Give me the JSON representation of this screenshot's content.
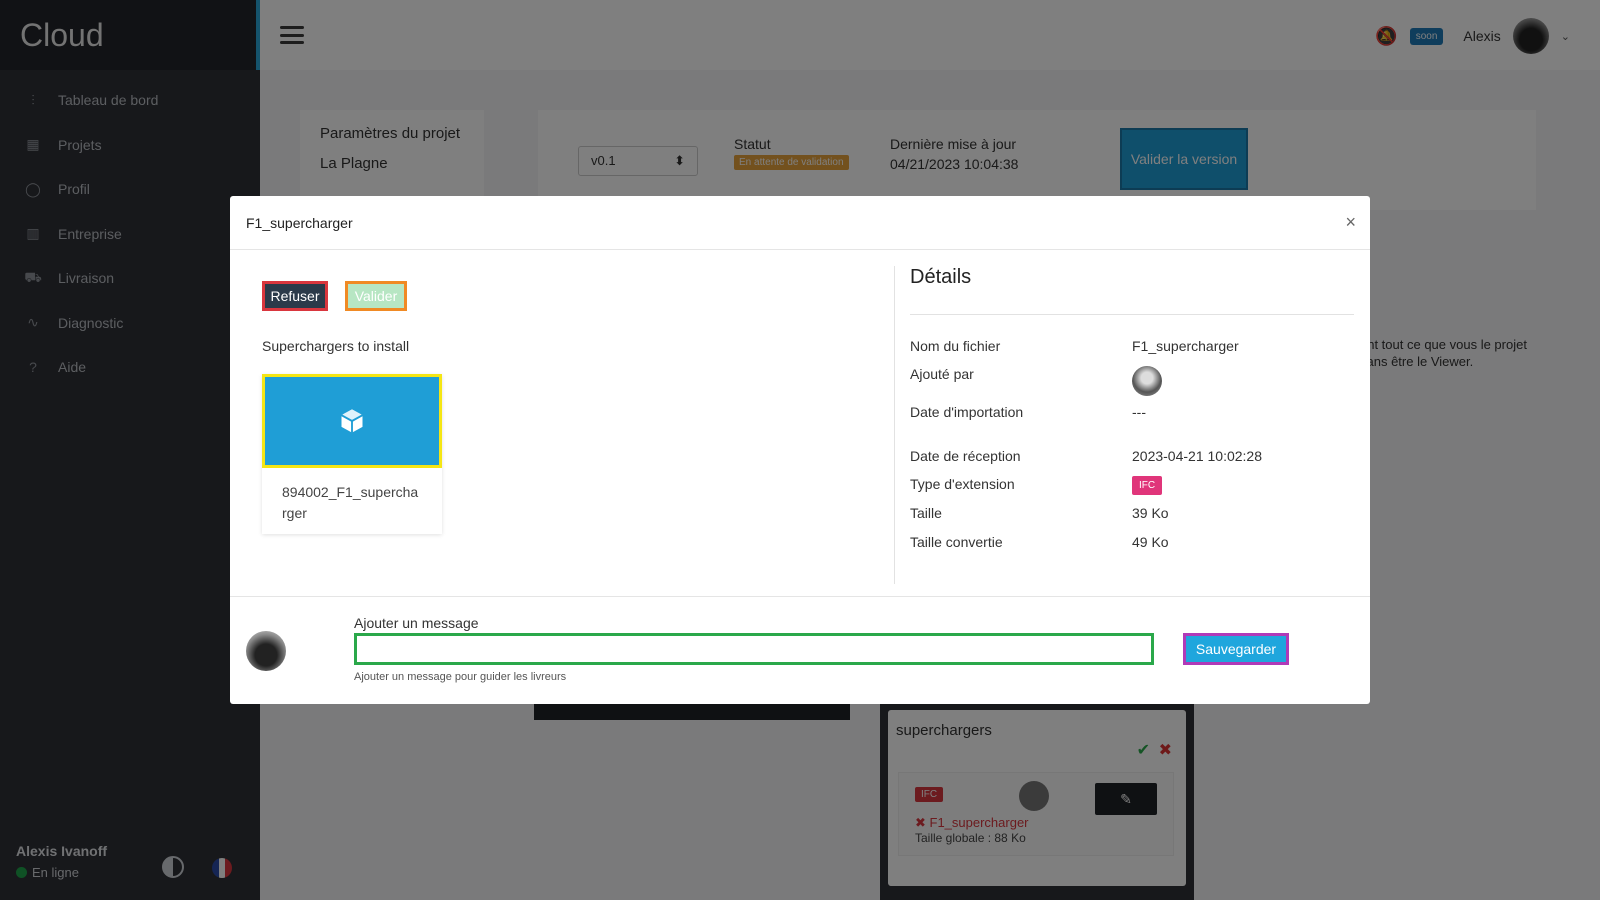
{
  "brand": "Cloud",
  "sidebar": {
    "items": [
      {
        "label": "Tableau de bord",
        "icon": "sliders-icon"
      },
      {
        "label": "Projets",
        "icon": "table-icon"
      },
      {
        "label": "Profil",
        "icon": "user-icon"
      },
      {
        "label": "Entreprise",
        "icon": "building-icon"
      },
      {
        "label": "Livraison",
        "icon": "truck-icon"
      },
      {
        "label": "Diagnostic",
        "icon": "pulse-icon"
      },
      {
        "label": "Aide",
        "icon": "help-icon"
      }
    ],
    "user_name": "Alexis Ivanoff",
    "user_status": "En ligne"
  },
  "header": {
    "badge": "soon",
    "user": "Alexis"
  },
  "background": {
    "project_settings": "Paramètres du projet",
    "project_name": "La Plagne",
    "version": "v0.1",
    "status_label": "Statut",
    "status_value": "En attente de validation",
    "updated_label": "Dernière mise à jour",
    "updated_value": "04/21/2023 10:04:38",
    "validate_version": "Valider la version",
    "info_text": "ont tout ce que vous le projet sans être le Viewer.",
    "card_title": "superchargers",
    "card_ifc": "IFC",
    "card_file": "F1_supercharger",
    "card_size": "Taille globale : 88 Ko"
  },
  "modal": {
    "title": "F1_supercharger",
    "refuse_label": "Refuser",
    "validate_label": "Valider",
    "section_label": "Superchargers to install",
    "file_name": "894002_F1_supercharger",
    "details_title": "Détails",
    "details": {
      "file_name_label": "Nom du fichier",
      "file_name_value": "F1_supercharger",
      "added_by_label": "Ajouté par",
      "import_date_label": "Date d'importation",
      "import_date_value": "---",
      "reception_date_label": "Date de réception",
      "reception_date_value": "2023-04-21 10:02:28",
      "ext_type_label": "Type d'extension",
      "ext_type_value": "IFC",
      "size_label": "Taille",
      "size_value": "39 Ko",
      "converted_size_label": "Taille convertie",
      "converted_size_value": "49 Ko"
    },
    "message_label": "Ajouter un message",
    "message_value": "",
    "message_hint": "Ajouter un message pour guider les livreurs",
    "save_label": "Sauvegarder"
  },
  "colors": {
    "accent": "#1f9ed6",
    "refuse_border": "#d9363e",
    "validate_border": "#f08a24",
    "file_border": "#f5e614",
    "input_border": "#2aa84a",
    "save_border": "#b03ab8",
    "ifc_badge": "#e0357a"
  }
}
